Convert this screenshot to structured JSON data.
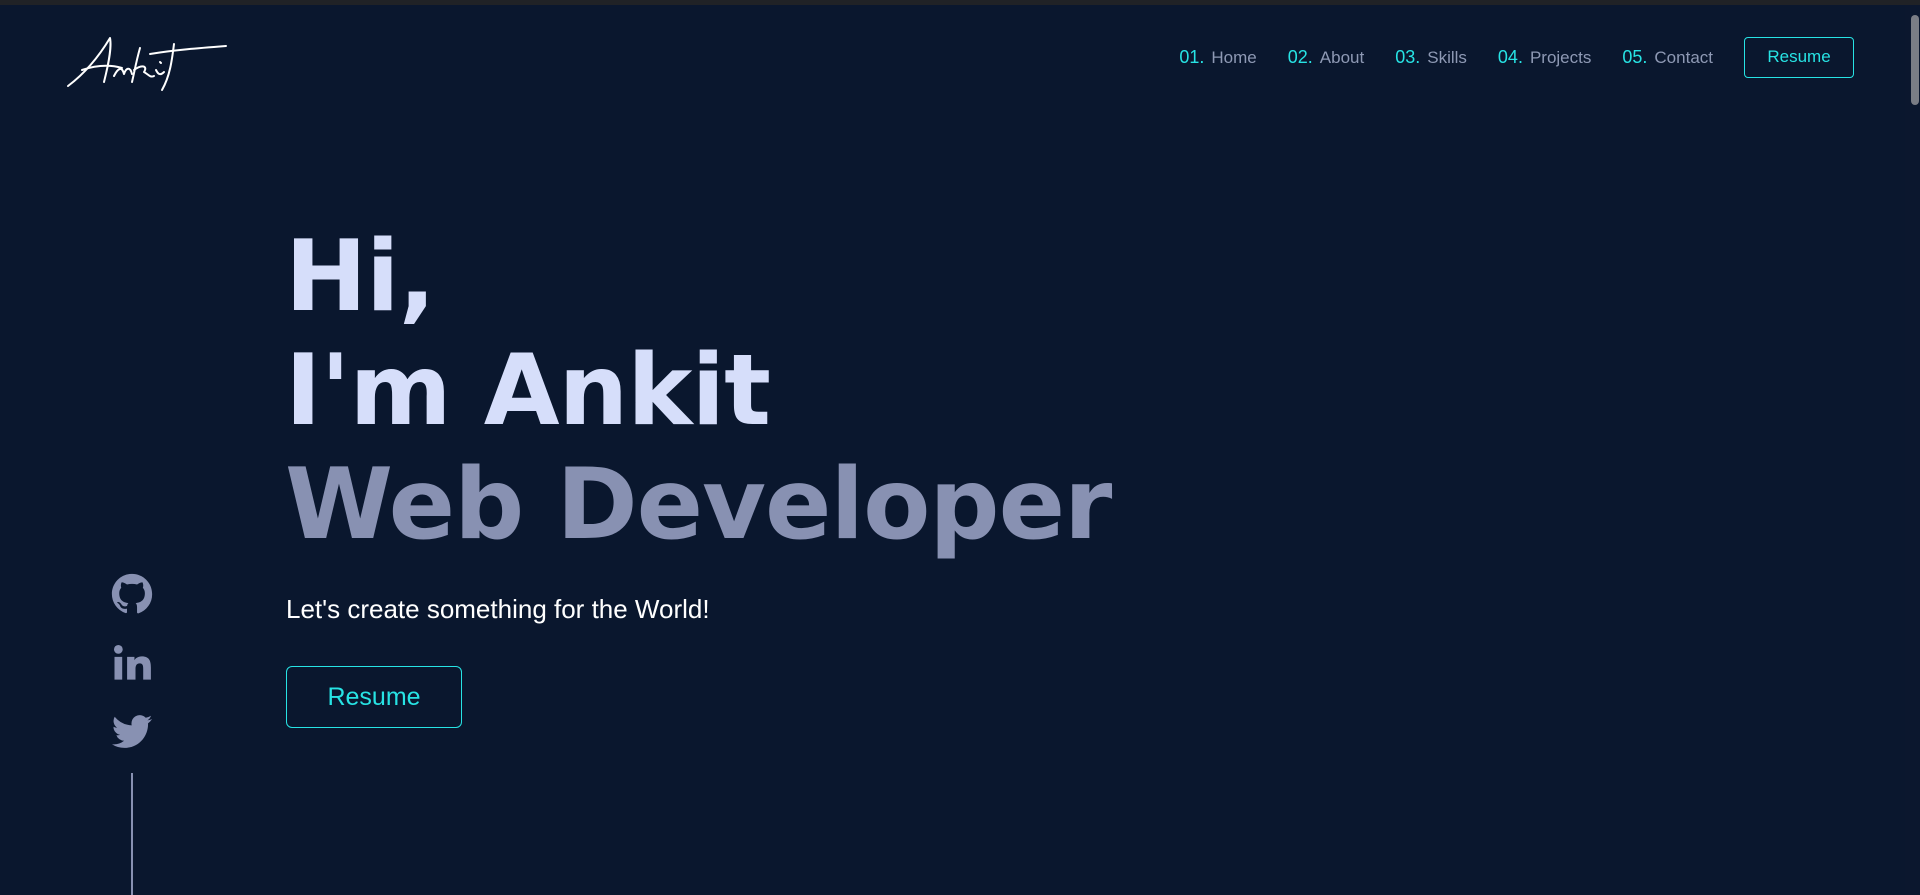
{
  "logo": {
    "text": "Ankit"
  },
  "nav": {
    "items": [
      {
        "num": "01.",
        "label": "Home"
      },
      {
        "num": "02.",
        "label": "About"
      },
      {
        "num": "03.",
        "label": "Skills"
      },
      {
        "num": "04.",
        "label": "Projects"
      },
      {
        "num": "05.",
        "label": "Contact"
      }
    ],
    "resume_label": "Resume"
  },
  "hero": {
    "line1": "Hi,",
    "line2": "I'm Ankit",
    "line3": "Web Developer",
    "tagline": "Let's create something for the World!",
    "resume_label": "Resume"
  },
  "social": {
    "icons": [
      "github-icon",
      "linkedin-icon",
      "twitter-icon"
    ]
  },
  "colors": {
    "background": "#0a172e",
    "accent": "#27e3e4",
    "heading": "#d6defa",
    "muted": "#8891b2"
  }
}
